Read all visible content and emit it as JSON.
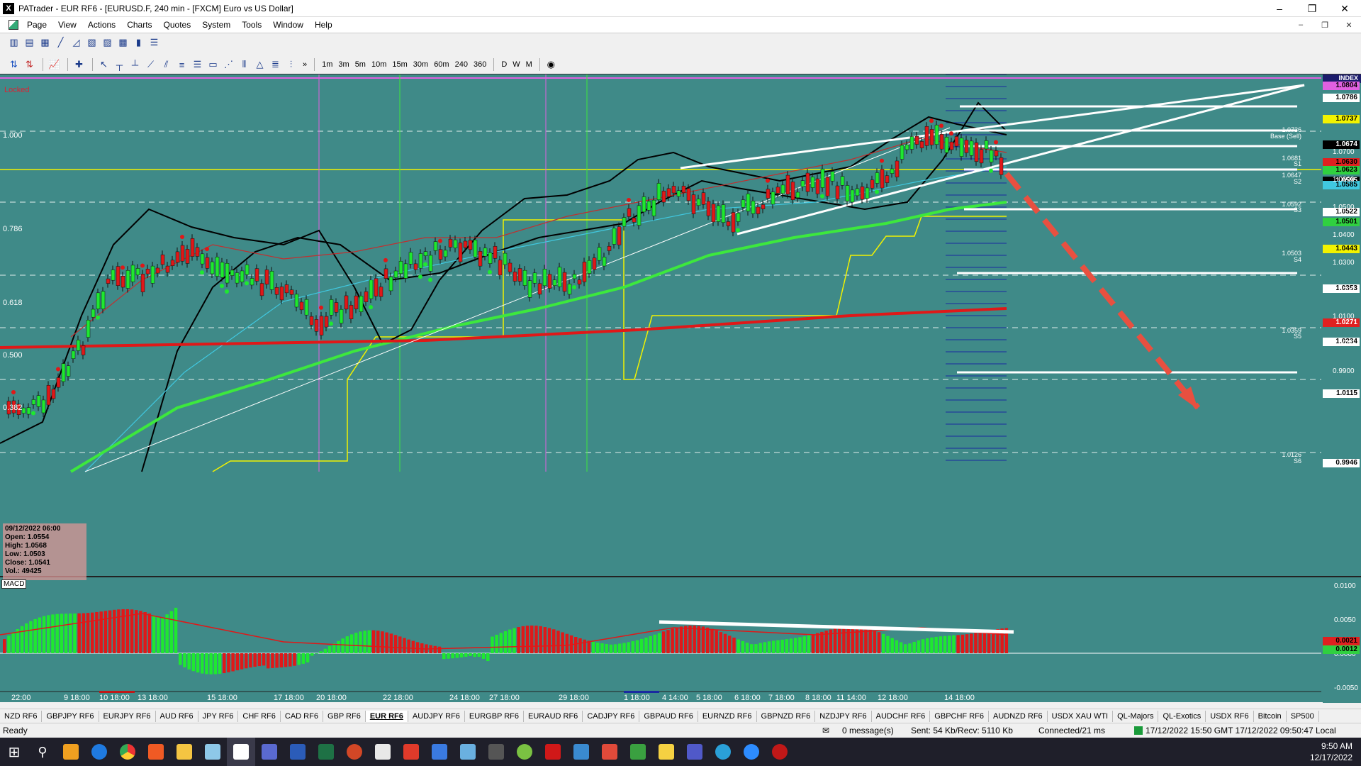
{
  "app": {
    "title": "PATrader - EUR RF6 - [EURUSD.F, 240 min - [FXCM] Euro vs US Dollar]",
    "icon_letter": "X"
  },
  "window_controls": [
    "–",
    "❐",
    "✕"
  ],
  "mdi_controls": [
    "–",
    "❐",
    "✕"
  ],
  "menu": [
    "Page",
    "View",
    "Actions",
    "Charts",
    "Quotes",
    "System",
    "Tools",
    "Window",
    "Help"
  ],
  "toolbar2": {
    "timeframes": [
      "1m",
      "3m",
      "5m",
      "10m",
      "15m",
      "30m",
      "60m",
      "240",
      "360"
    ],
    "periods": [
      "D",
      "W",
      "M"
    ],
    "more": "»"
  },
  "chart": {
    "locked_label": "Locked",
    "index_label": "INDEX",
    "fib_labels": [
      "1.000",
      "0.786",
      "0.618",
      "0.500",
      "0.382"
    ],
    "pivot_levels": [
      {
        "value": "1.0736",
        "name": "Base (Sell)"
      },
      {
        "value": "1.0681",
        "name": "S1"
      },
      {
        "value": "1.0647",
        "name": "S2"
      },
      {
        "value": "1.0592",
        "name": "S3"
      },
      {
        "value": "1.0503",
        "name": "S4"
      },
      {
        "value": "1.0359",
        "name": "S5"
      },
      {
        "value": "1.0126",
        "name": "S6"
      }
    ],
    "price_labels": [
      {
        "text": "1.0804",
        "bg": "#e060e0",
        "fg": "#000000"
      },
      {
        "text": "1.0786",
        "bg": "#ffffff",
        "fg": "#000000"
      },
      {
        "text": "1.0737",
        "bg": "#f2f200",
        "fg": "#000000"
      },
      {
        "text": "1.0674",
        "bg": "#000000",
        "fg": "#ffffff"
      },
      {
        "text": "1.0630",
        "bg": "#e02020",
        "fg": "#000000"
      },
      {
        "text": "1.0623",
        "bg": "#30d040",
        "fg": "#000000"
      },
      {
        "text": "1.0595",
        "bg": "#000000",
        "fg": "#ffffff"
      },
      {
        "text": "1.0585",
        "bg": "#40c8e0",
        "fg": "#000000"
      },
      {
        "text": "1.0522",
        "bg": "#ffffff",
        "fg": "#000000"
      },
      {
        "text": "1.0501",
        "bg": "#30d040",
        "fg": "#000000"
      },
      {
        "text": "1.0443",
        "bg": "#f2f200",
        "fg": "#000000"
      },
      {
        "text": "1.0353",
        "bg": "#ffffff",
        "fg": "#000000"
      },
      {
        "text": "1.0271",
        "bg": "#e02020",
        "fg": "#ffffff"
      },
      {
        "text": "1.0234",
        "bg": "#ffffff",
        "fg": "#000000"
      },
      {
        "text": "1.0115",
        "bg": "#ffffff",
        "fg": "#000000"
      },
      {
        "text": "0.9946",
        "bg": "#ffffff",
        "fg": "#000000"
      }
    ],
    "price_scale": [
      "1.0700",
      "1.0600",
      "1.0500",
      "1.0400",
      "1.0300",
      "1.0200",
      "1.0100",
      "1.0000",
      "0.9900"
    ],
    "ohlc_box": {
      "date": "09/12/2022 06:00",
      "open": "Open: 1.0554",
      "high": "High: 1.0568",
      "low": "Low: 1.0503",
      "close": "Close: 1.0541",
      "vol": "Vol.: 49425"
    },
    "macd_label": "MACD",
    "macd_scale": [
      "0.0100",
      "0.0050",
      "0.0000",
      "-0.0050"
    ],
    "macd_values": [
      {
        "text": "0.0021",
        "bg": "#e02020"
      },
      {
        "text": "0.0012",
        "bg": "#30d040"
      }
    ],
    "date_labels": [
      "22:00",
      "9 18:00",
      "10 18:00",
      "13 18:00",
      "15 18:00",
      "17 18:00",
      "20 18:00",
      "22 18:00",
      "24 18:00",
      "27 18:00",
      "29 18:00",
      "1 18:00",
      "4 14:00",
      "5 18:00",
      "6 18:00",
      "7 18:00",
      "8 18:00",
      "11 14:00",
      "12 18:00",
      "14 18:00"
    ]
  },
  "tabs": [
    "NZD RF6",
    "GBPJPY RF6",
    "EURJPY RF6",
    "AUD RF6",
    "JPY RF6",
    "CHF RF6",
    "CAD RF6",
    "GBP RF6",
    "EUR RF6",
    "AUDJPY RF6",
    "EURGBP RF6",
    "EURAUD RF6",
    "CADJPY RF6",
    "GBPAUD RF6",
    "EURNZD RF6",
    "GBPNZD RF6",
    "NZDJPY RF6",
    "AUDCHF RF6",
    "GBPCHF RF6",
    "AUDNZD RF6",
    "USDX XAU WTI",
    "QL-Majors",
    "QL-Exotics",
    "USDX RF6",
    "Bitcoin",
    "SP500"
  ],
  "active_tab": "EUR RF6",
  "status": {
    "ready": "Ready",
    "messages": "0 message(s)",
    "traffic": "Sent: 54 Kb/Recv: 5110 Kb",
    "connection": "Connected/21 ms",
    "times": "17/12/2022 15:50 GMT  17/12/2022 09:50:47 Local"
  },
  "taskbar": {
    "time": "9:50 AM",
    "date": "12/17/2022"
  },
  "colors": {
    "chart_bg": "#3f8a88",
    "bull": "#1ee830",
    "bear": "#e01818",
    "ma_red": "#e01818",
    "ma_green": "#3de83d",
    "boll": "#000000",
    "cyan_ma": "#40c8e0",
    "yellow_line": "#f2f200",
    "magenta_line": "#e060e0"
  }
}
